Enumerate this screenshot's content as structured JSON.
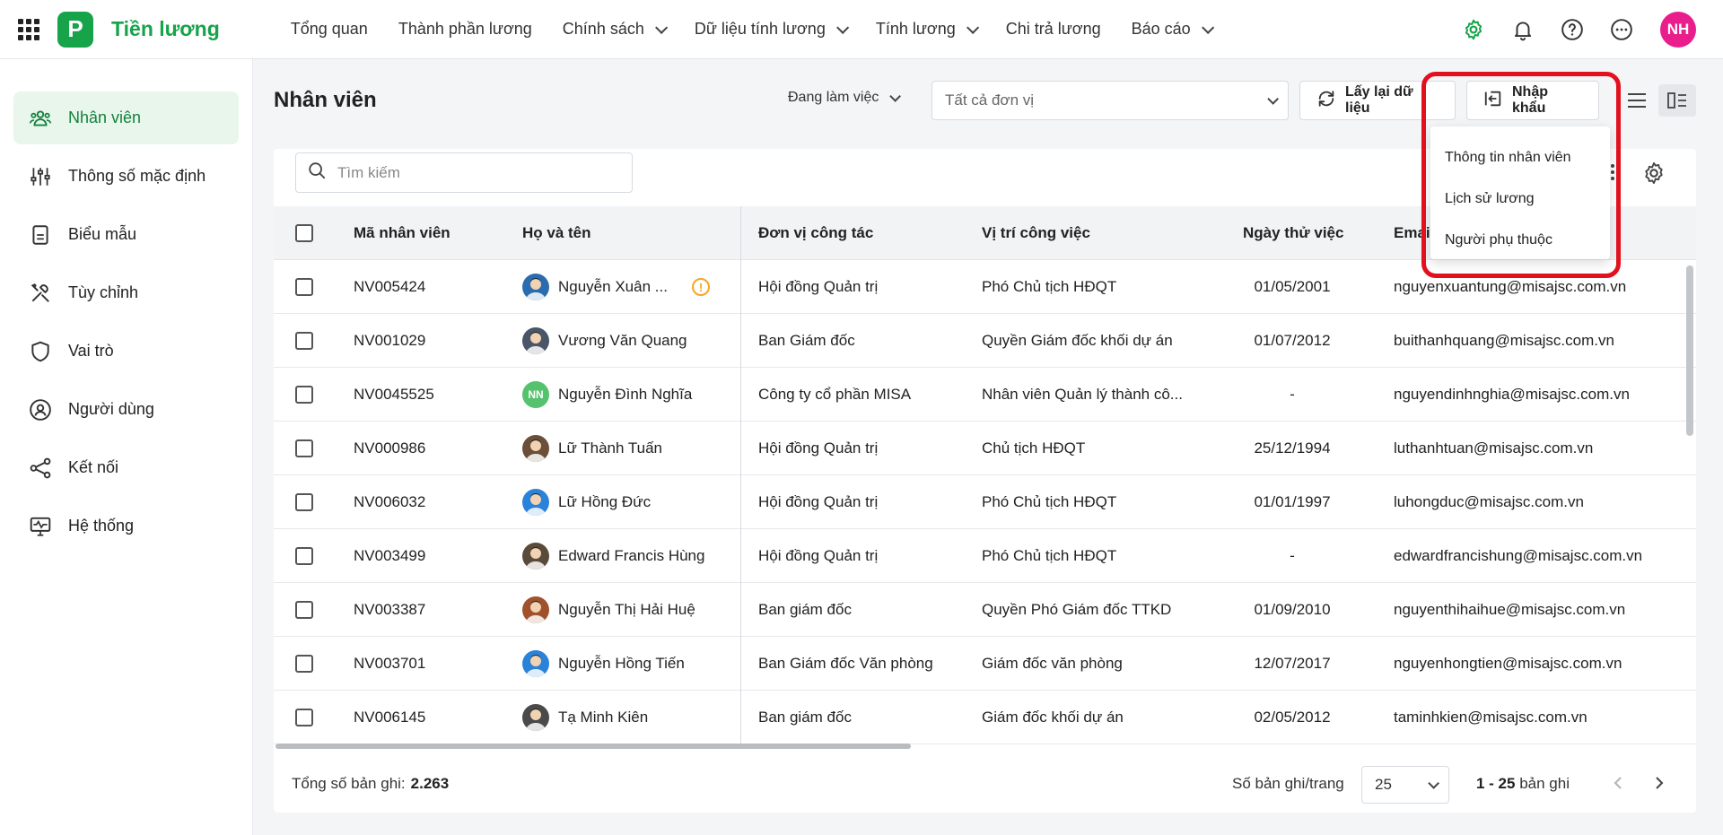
{
  "app": {
    "logo_letter": "P",
    "name": "Tiền lương"
  },
  "nav": [
    {
      "label": "Tổng quan",
      "dropdown": false
    },
    {
      "label": "Thành phần lương",
      "dropdown": false
    },
    {
      "label": "Chính sách",
      "dropdown": true
    },
    {
      "label": "Dữ liệu tính lương",
      "dropdown": true
    },
    {
      "label": "Tính lương",
      "dropdown": true
    },
    {
      "label": "Chi trả lương",
      "dropdown": false
    },
    {
      "label": "Báo cáo",
      "dropdown": true
    }
  ],
  "top_icons": [
    "gear-icon",
    "bell-icon",
    "help-icon",
    "more-icon"
  ],
  "user": {
    "initials": "NH",
    "color": "#e91e8c"
  },
  "sidebar": {
    "items": [
      {
        "label": "Nhân viên",
        "icon": "employees-icon",
        "active": true
      },
      {
        "label": "Thông số mặc định",
        "icon": "sliders-icon",
        "active": false
      },
      {
        "label": "Biểu mẫu",
        "icon": "form-icon",
        "active": false
      },
      {
        "label": "Tùy chỉnh",
        "icon": "tools-icon",
        "active": false
      },
      {
        "label": "Vai trò",
        "icon": "shield-icon",
        "active": false
      },
      {
        "label": "Người dùng",
        "icon": "user-circle-icon",
        "active": false
      },
      {
        "label": "Kết nối",
        "icon": "share-icon",
        "active": false
      },
      {
        "label": "Hệ thống",
        "icon": "monitor-icon",
        "active": false
      }
    ]
  },
  "header": {
    "title": "Nhân viên",
    "status_filter": "Đang làm việc",
    "unit_filter": "Tất cả đơn vị",
    "refresh_label": "Lấy lại dữ liệu",
    "import_label": "Nhập khẩu"
  },
  "import_menu": [
    "Thông tin nhân viên",
    "Lịch sử lương",
    "Người phụ thuộc"
  ],
  "search": {
    "placeholder": "Tìm kiếm"
  },
  "table": {
    "columns": [
      "Mã nhân viên",
      "Họ và tên",
      "Đơn vị công tác",
      "Vị trí công việc",
      "Ngày thử việc",
      "Email"
    ],
    "rows": [
      {
        "code": "NV005424",
        "name": "Nguyễn Xuân ...",
        "unit": "Hội đồng Quản trị",
        "position": "Phó Chủ tịch HĐQT",
        "date": "01/05/2001",
        "email": "nguyenxuantung@misajsc.com.vn",
        "warning": true,
        "avatar": "photo"
      },
      {
        "code": "NV001029",
        "name": "Vương Văn Quang",
        "unit": "Ban Giám đốc",
        "position": "Quyền Giám đốc khối dự án",
        "date": "01/07/2012",
        "email": "buithanhquang@misajsc.com.vn",
        "warning": false,
        "avatar": "photo"
      },
      {
        "code": "NV0045525",
        "name": "Nguyễn Đình Nghĩa",
        "unit": "Công ty cổ phần MISA",
        "position": "Nhân viên Quản lý thành cô...",
        "date": "-",
        "email": "nguyendinhnghia@misajsc.com.vn",
        "warning": false,
        "avatar": "NN"
      },
      {
        "code": "NV000986",
        "name": "Lữ Thành Tuấn",
        "unit": "Hội đồng Quản trị",
        "position": "Chủ tịch HĐQT",
        "date": "25/12/1994",
        "email": "luthanhtuan@misajsc.com.vn",
        "warning": false,
        "avatar": "photo"
      },
      {
        "code": "NV006032",
        "name": "Lữ Hồng Đức",
        "unit": "Hội đồng Quản trị",
        "position": "Phó Chủ tịch HĐQT",
        "date": "01/01/1997",
        "email": "luhongduc@misajsc.com.vn",
        "warning": false,
        "avatar": "photo"
      },
      {
        "code": "NV003499",
        "name": "Edward Francis Hùng",
        "unit": "Hội đồng Quản trị",
        "position": "Phó Chủ tịch HĐQT",
        "date": "-",
        "email": "edwardfrancishung@misajsc.com.vn",
        "warning": false,
        "avatar": "photo"
      },
      {
        "code": "NV003387",
        "name": "Nguyễn Thị Hải Huệ",
        "unit": "Ban giám đốc",
        "position": "Quyền Phó Giám đốc TTKD",
        "date": "01/09/2010",
        "email": "nguyenthihaihue@misajsc.com.vn",
        "warning": false,
        "avatar": "photo"
      },
      {
        "code": "NV003701",
        "name": "Nguyễn Hồng Tiến",
        "unit": "Ban Giám đốc Văn phòng",
        "position": "Giám đốc văn phòng",
        "date": "12/07/2017",
        "email": "nguyenhongtien@misajsc.com.vn",
        "warning": false,
        "avatar": "photo"
      },
      {
        "code": "NV006145",
        "name": "Tạ Minh Kiên",
        "unit": "Ban giám đốc",
        "position": "Giám đốc khối dự án",
        "date": "02/05/2012",
        "email": "taminhkien@misajsc.com.vn",
        "warning": false,
        "avatar": "photo"
      }
    ]
  },
  "footer": {
    "total_label": "Tổng số bản ghi:",
    "total_value": "2.263",
    "per_page_label": "Số bản ghi/trang",
    "per_page_value": "25",
    "range_bold": "1 - 25",
    "range_suffix": "bản ghi"
  },
  "colors": {
    "brand": "#16a34a",
    "highlight": "#e3101e",
    "warning": "#f5a623"
  }
}
